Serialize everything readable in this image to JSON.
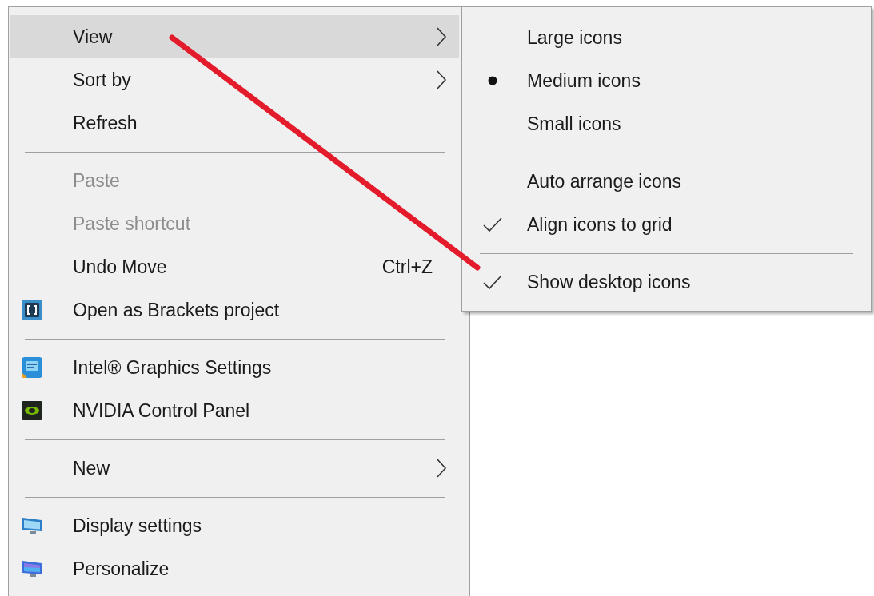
{
  "context_menu": {
    "items": [
      {
        "kind": "command",
        "label": "View",
        "selected": true,
        "disabled": false,
        "submenu": true
      },
      {
        "kind": "command",
        "label": "Sort by",
        "selected": false,
        "disabled": false,
        "submenu": true
      },
      {
        "kind": "command",
        "label": "Refresh",
        "selected": false,
        "disabled": false,
        "submenu": false
      },
      {
        "kind": "separator"
      },
      {
        "kind": "command",
        "label": "Paste",
        "selected": false,
        "disabled": true,
        "submenu": false
      },
      {
        "kind": "command",
        "label": "Paste shortcut",
        "selected": false,
        "disabled": true,
        "submenu": false
      },
      {
        "kind": "command",
        "label": "Undo Move",
        "shortcut": "Ctrl+Z",
        "selected": false,
        "disabled": false,
        "submenu": false
      },
      {
        "kind": "command",
        "label": "Open as Brackets project",
        "selected": false,
        "disabled": false,
        "submenu": false
      },
      {
        "kind": "separator"
      },
      {
        "kind": "command",
        "label": "Intel® Graphics Settings",
        "selected": false,
        "disabled": false,
        "submenu": false
      },
      {
        "kind": "command",
        "label": "NVIDIA Control Panel",
        "selected": false,
        "disabled": false,
        "submenu": false
      },
      {
        "kind": "separator"
      },
      {
        "kind": "command",
        "label": "New",
        "selected": false,
        "disabled": false,
        "submenu": true
      },
      {
        "kind": "separator"
      },
      {
        "kind": "command",
        "label": "Display settings",
        "selected": false,
        "disabled": false,
        "submenu": false
      },
      {
        "kind": "command",
        "label": "Personalize",
        "selected": false,
        "disabled": false,
        "submenu": false
      }
    ]
  },
  "view_submenu": {
    "items": [
      {
        "kind": "radio",
        "label": "Large icons",
        "checked": false
      },
      {
        "kind": "radio",
        "label": "Medium icons",
        "checked": true
      },
      {
        "kind": "radio",
        "label": "Small icons",
        "checked": false
      },
      {
        "kind": "separator"
      },
      {
        "kind": "check",
        "label": "Auto arrange icons",
        "checked": false
      },
      {
        "kind": "check",
        "label": "Align icons to grid",
        "checked": true
      },
      {
        "kind": "separator"
      },
      {
        "kind": "check",
        "label": "Show desktop icons",
        "checked": true
      }
    ]
  }
}
